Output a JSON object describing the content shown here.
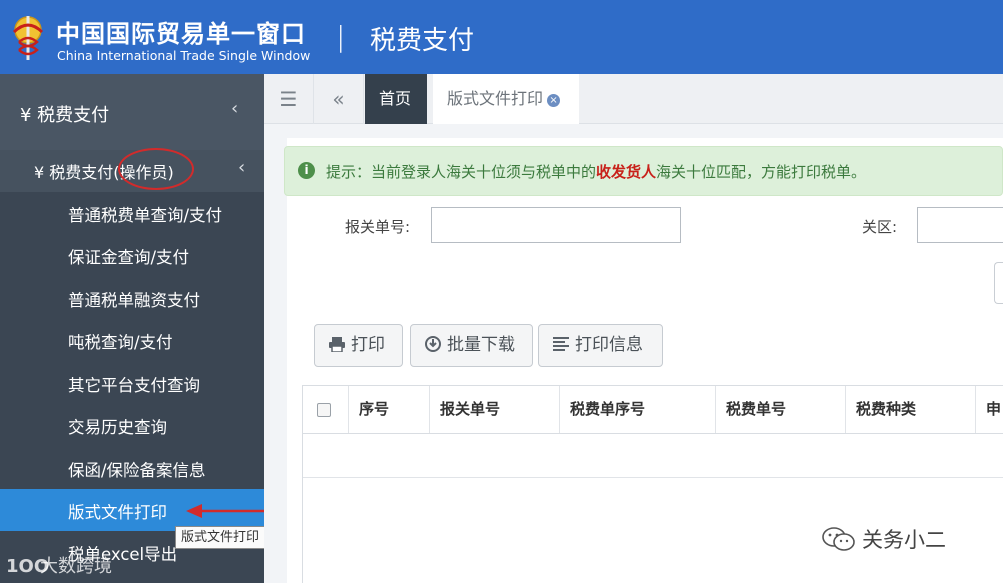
{
  "header": {
    "brand_cn": "中国国际贸易单一窗口",
    "brand_en": "China International Trade Single Window",
    "separator": "|",
    "module_title": "税费支付"
  },
  "sidebar": {
    "level1": {
      "label": "¥ 税费支付",
      "chevron": "‹"
    },
    "level2": {
      "label": "¥ 税费支付(操作员)",
      "chevron": "‹"
    },
    "items": [
      {
        "label": "普通税费单查询/支付"
      },
      {
        "label": "保证金查询/支付"
      },
      {
        "label": "普通税单融资支付"
      },
      {
        "label": "吨税查询/支付"
      },
      {
        "label": "其它平台支付查询"
      },
      {
        "label": "交易历史查询"
      },
      {
        "label": "保函/保险备案信息"
      },
      {
        "label": "版式文件打印"
      },
      {
        "label": "税单excel导出"
      }
    ],
    "active_index": 7,
    "tooltip": "版式文件打印"
  },
  "tabbar": {
    "menu_toggle_icon": "☰",
    "back_icon": "«",
    "tabs": [
      {
        "label": "首页"
      },
      {
        "label": "版式文件打印"
      }
    ],
    "close_glyph": "×"
  },
  "notice": {
    "icon": "i",
    "text_before": "提示：当前登录人海关十位须与税单中的",
    "highlight": "收发货人",
    "text_after": "海关十位匹配，方能打印税单。"
  },
  "form": {
    "declaration_no_label": "报关单号:",
    "declaration_no_value": "",
    "customs_area_label": "关区:",
    "customs_area_value": ""
  },
  "toolbar": {
    "print_label": "打印",
    "batch_download_label": "批量下载",
    "print_info_label": "打印信息"
  },
  "table": {
    "columns": [
      "序号",
      "报关单号",
      "税费单序号",
      "税费单号",
      "税费种类",
      "申"
    ]
  },
  "watermarks": {
    "left_logo": "1OO",
    "left_text": "大数跨境",
    "right_text": "关务小二"
  },
  "colors": {
    "header_bg": "#2f6cc8",
    "sidebar_bg": "#3b4653",
    "active_item_bg": "#2d8ad9",
    "notice_bg": "#ddf0da",
    "notice_highlight": "#c8211a",
    "annotation_red": "#d22b2b"
  }
}
